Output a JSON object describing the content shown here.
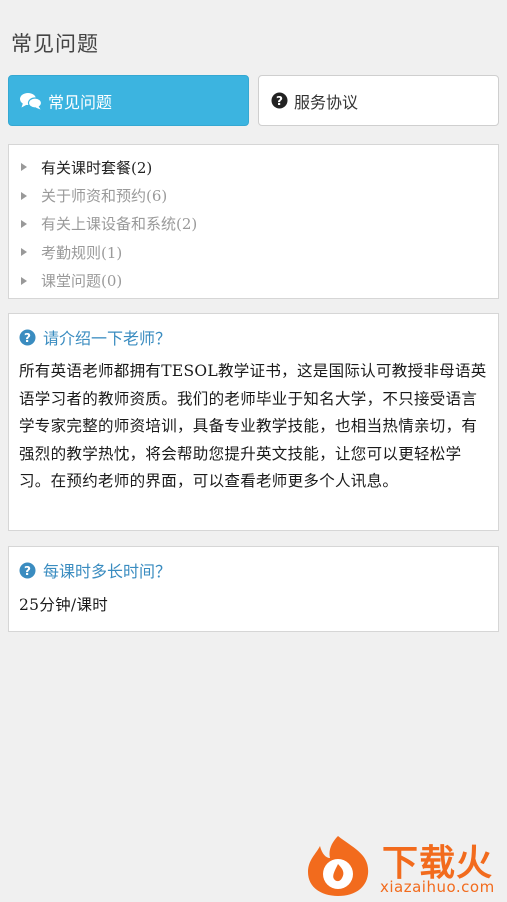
{
  "page": {
    "title": "常见问题"
  },
  "tabs": [
    {
      "label": "常见问题",
      "icon": "chat-bubbles-icon",
      "active": true
    },
    {
      "label": "服务协议",
      "icon": "question-circle-icon",
      "active": false
    }
  ],
  "categories": [
    {
      "label": "有关课时套餐(2)",
      "active": true
    },
    {
      "label": "关于师资和预约(6)",
      "active": false
    },
    {
      "label": "有关上课设备和系统(2)",
      "active": false
    },
    {
      "label": "考勤规则(1)",
      "active": false
    },
    {
      "label": "课堂问题(0)",
      "active": false
    }
  ],
  "faq": [
    {
      "question": "请介绍一下老师？",
      "answer": "所有英语老师都拥有TESOL教学证书，这是国际认可教授非母语英语学习者的教师资质。我们的老师毕业于知名大学，不只接受语言学专家完整的师资培训，具备专业教学技能，也相当热情亲切，有强烈的教学热忱，将会帮助您提升英文技能，让您可以更轻松学习。在预约老师的界面，可以查看老师更多个人讯息。"
    },
    {
      "question": "每课时多长时间？",
      "answer": "25分钟/课时"
    }
  ],
  "watermark": {
    "brand": "下载火",
    "domain": "xiazaihuo.com"
  },
  "colors": {
    "accent": "#3cb4e0",
    "question": "#3a8cc0",
    "watermark": "#f26b1d"
  }
}
